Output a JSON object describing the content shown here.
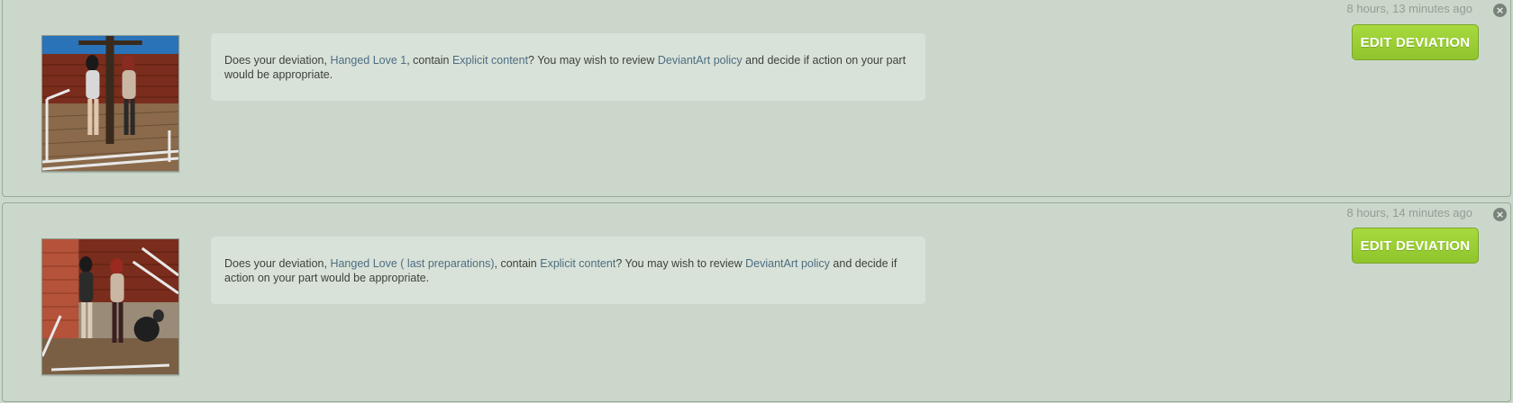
{
  "notifications": [
    {
      "timestamp": "8 hours, 13 minutes ago",
      "close_icon": "close-icon",
      "thumbnail_icon": "deviation-thumbnail",
      "message": {
        "prefix": "Does your deviation, ",
        "deviation_link": "Hanged Love 1",
        "middle": ", contain ",
        "content_link": "Explicit content",
        "after_content": "? You may wish to review ",
        "policy_link": "DeviantArt policy",
        "suffix": " and decide if action on your part would be appropriate."
      },
      "edit_button_label": "EDIT DEVIATION"
    },
    {
      "timestamp": "8 hours, 14 minutes ago",
      "close_icon": "close-icon",
      "thumbnail_icon": "deviation-thumbnail",
      "message": {
        "prefix": "Does your deviation, ",
        "deviation_link": "Hanged Love ( last preparations)",
        "middle": ", contain ",
        "content_link": "Explicit content",
        "after_content": "? You may wish to review ",
        "policy_link": "DeviantArt policy",
        "suffix": " and decide if action on your part would be appropriate."
      },
      "edit_button_label": "EDIT DEVIATION"
    }
  ],
  "colors": {
    "background": "#ccd7cb",
    "message_box": "#d9e2d8",
    "link": "#4c6d82",
    "button_green": "#9ccf36",
    "timestamp": "#939d93"
  }
}
